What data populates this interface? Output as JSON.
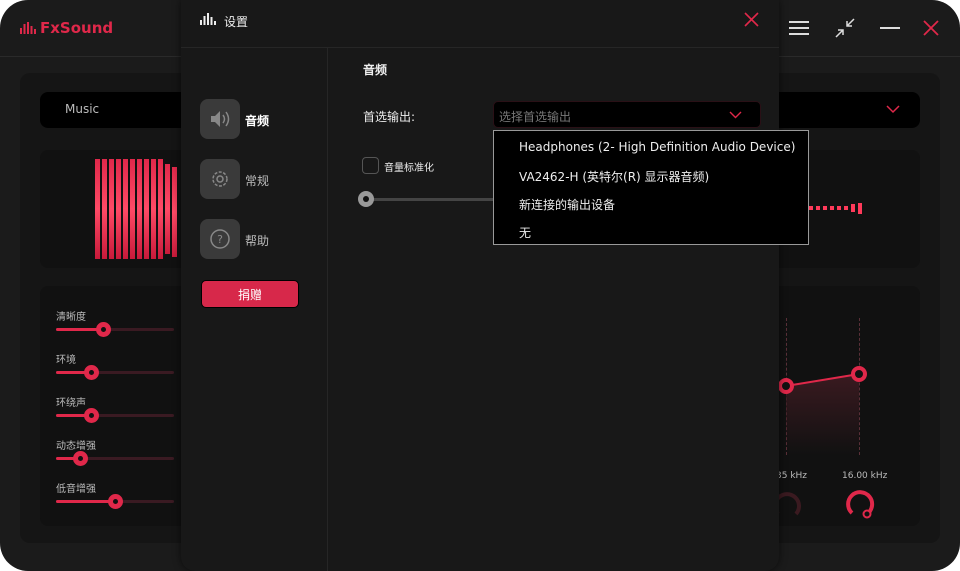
{
  "app": {
    "name": "FxSound",
    "preset": "Music",
    "accent": "#e0284a"
  },
  "window_controls": [
    {
      "icon": "menu-icon"
    },
    {
      "icon": "shrink-icon"
    },
    {
      "icon": "minimize-icon"
    },
    {
      "icon": "close-icon"
    }
  ],
  "effects": [
    {
      "label": "清晰度",
      "value": 0.4
    },
    {
      "label": "环境",
      "value": 0.3
    },
    {
      "label": "环绕声",
      "value": 0.3
    },
    {
      "label": "动态增强",
      "value": 0.2
    },
    {
      "label": "低音增强",
      "value": 0.5
    }
  ],
  "eq": {
    "labels": [
      "35 kHz",
      "16.00 kHz"
    ]
  },
  "settings": {
    "title": "设置",
    "nav": [
      {
        "label": "音频",
        "icon": "speaker-icon"
      },
      {
        "label": "常规",
        "icon": "gear-icon"
      },
      {
        "label": "帮助",
        "icon": "help-icon"
      }
    ],
    "donate": "捐赠",
    "section": "音频",
    "output_label": "首选输出:",
    "output_placeholder": "选择首选输出",
    "output_options": [
      "Headphones (2- High Definition Audio Device)",
      "VA2462-H (英特尔(R) 显示器音频)",
      "新连接的输出设备",
      "无"
    ],
    "normalize_label": "音量标准化",
    "normalize_checked": false
  }
}
